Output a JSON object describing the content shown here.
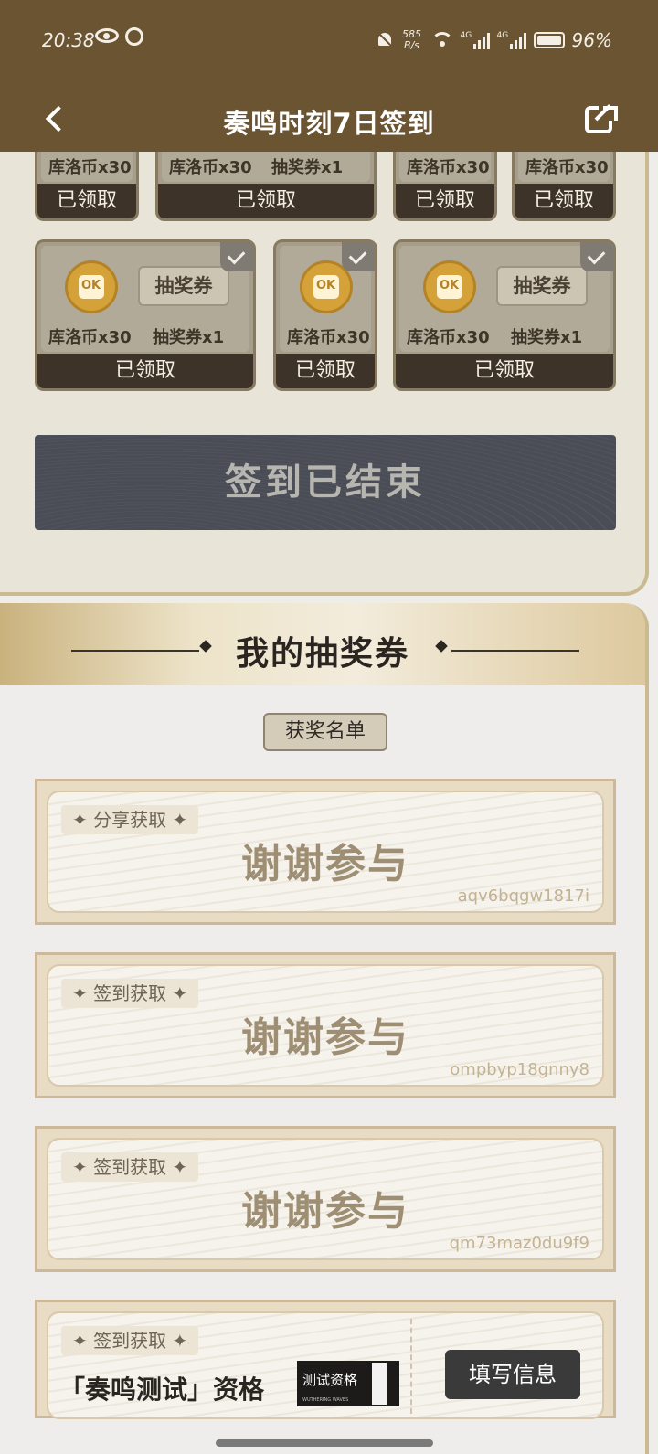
{
  "status_bar": {
    "time": "20:38",
    "net_speed_top": "585",
    "net_speed_bottom": "B/s",
    "network_tag_1": "4G",
    "network_tag_2": "4G",
    "battery": "96%"
  },
  "header": {
    "title": "奏鸣时刻7日签到"
  },
  "signin": {
    "top_row": [
      {
        "reward": "库洛币x30",
        "status": "已领取"
      },
      {
        "reward": "库洛币x30",
        "reward2": "抽奖券x1",
        "status": "已领取"
      },
      {
        "reward": "库洛币x30",
        "status": "已领取"
      },
      {
        "reward": "库洛币x30",
        "status": "已领取"
      }
    ],
    "second_row": [
      {
        "reward": "库洛币x30",
        "ticket_label": "抽奖券",
        "reward2": "抽奖券x1",
        "status": "已领取"
      },
      {
        "reward": "库洛币x30",
        "status": "已领取"
      },
      {
        "reward": "库洛币x30",
        "ticket_label": "抽奖券",
        "reward2": "抽奖券x1",
        "status": "已领取"
      }
    ],
    "ended_label": "签到已结束"
  },
  "tickets": {
    "title": "我的抽奖券",
    "winners_button": "获奖名单",
    "items": [
      {
        "source": "✦ 分享获取 ✦",
        "result": "谢谢参与",
        "code": "aqv6bqgw1817i"
      },
      {
        "source": "✦ 签到获取 ✦",
        "result": "谢谢参与",
        "code": "ompbyp18gnny8"
      },
      {
        "source": "✦ 签到获取 ✦",
        "result": "谢谢参与",
        "code": "qm73maz0du9f9"
      }
    ],
    "last": {
      "source": "✦ 签到获取 ✦",
      "prize": "「奏鸣测试」资格",
      "badge_text": "测试资格",
      "badge_small": "WUTHERING WAVES",
      "button": "填写信息"
    }
  }
}
